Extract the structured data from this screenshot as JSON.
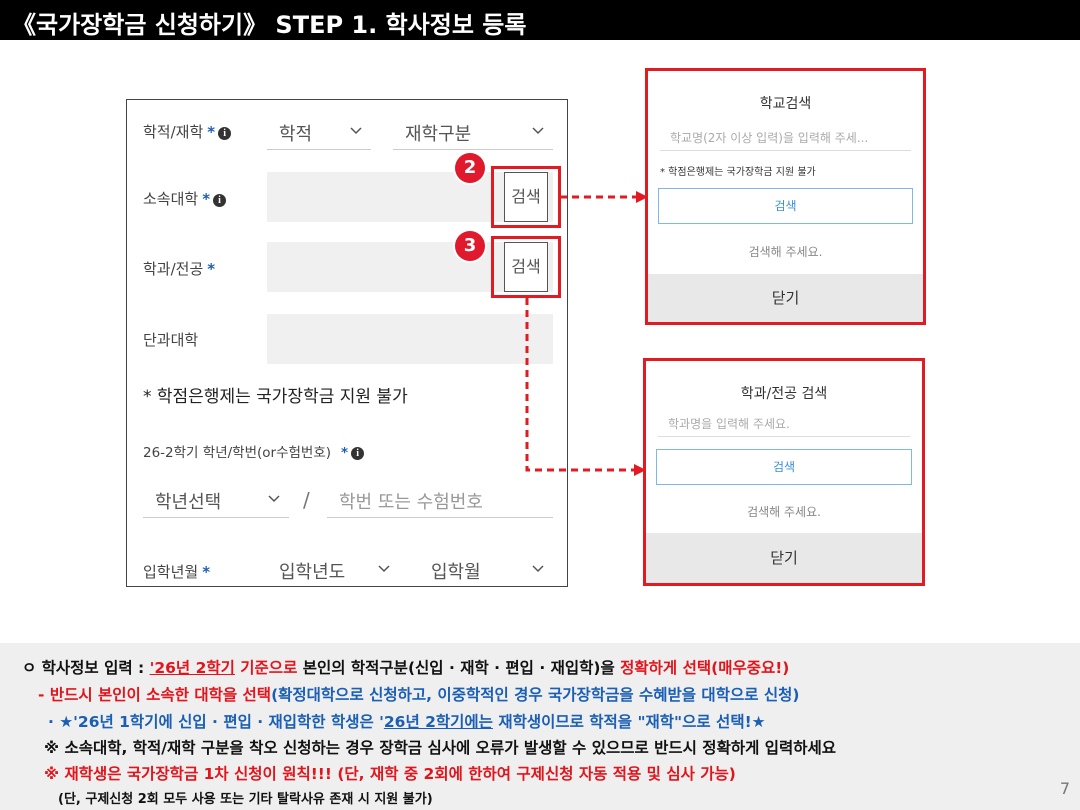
{
  "title": "《국가장학금 신청하기》 STEP 1. 학사정보 등록",
  "form": {
    "row1": {
      "label": "학적/재학",
      "required": "*",
      "info": "i",
      "select1": "학적",
      "select2": "재학구분"
    },
    "row2": {
      "label": "소속대학",
      "required": "*",
      "info": "i",
      "button": "검색",
      "badge": "2"
    },
    "row3": {
      "label": "학과/전공",
      "required": "*",
      "button": "검색",
      "badge": "3"
    },
    "row4": {
      "label": "단과대학"
    },
    "note": "* 학점은행제는 국가장학금 지원 불가",
    "row5": {
      "label": "26-2학기 학년/학번(or수험번호)",
      "required": "*",
      "info": "i",
      "select": "학년선택",
      "slash": "/",
      "placeholder": "학번 또는 수험번호"
    },
    "row6": {
      "label": "입학년월",
      "required": "*",
      "select1": "입학년도",
      "select2": "입학월"
    }
  },
  "popup_school": {
    "title": "학교검색",
    "placeholder": "학교명(2자 이상 입력)을 입력해 주세...",
    "note": "* 학점은행제는 국가장학금 지원 불가",
    "search": "검색",
    "empty": "검색해 주세요.",
    "close": "닫기"
  },
  "popup_major": {
    "title": "학과/전공 검색",
    "placeholder": "학과명을 입력해 주세요.",
    "search": "검색",
    "empty": "검색해 주세요.",
    "close": "닫기"
  },
  "info": {
    "l1": {
      "a": "ㅇ 학사정보 입력 : ",
      "b": "'26년 2학기",
      "c": " 기준으로",
      "d": " 본인의 학적구분(신입 · 재학 · 편입 · 재입학)을 ",
      "e": "정확하게 선택(매우중요!)"
    },
    "l2": {
      "a": "- 반드시 본인이 소속한 대학을 선택",
      "b": "(확정대학으로 신청하고, 이중학적인 경우 국가장학금을 수혜받을 대학으로 신청)"
    },
    "l3": {
      "a": "· ★'26년 1학기에 신입 · 편입 · 재입학한 학생은 '",
      "b": "26년 2학기에는",
      "c": " 재학생이므로 학적을 \"재학\"으로 선택!★"
    },
    "l4": "※ 소속대학, 학적/재학 구분을 착오 신청하는 경우 장학금 심사에 오류가 발생할 수 있으므로 반드시 정확하게 입력하세요",
    "l5": "※ 재학생은 국가장학금 1차 신청이 원칙!!! (단, 재학 중 2회에 한하여 구제신청 자동 적용 및 심사 가능)",
    "l6": "(단, 구제신청 2회 모두 사용 또는 기타 탈락사유 존재 시 지원 불가)"
  },
  "page_number": "7",
  "colors": {
    "accent_red": "#e21a22",
    "blue": "#1a5fb4",
    "title_bg": "#000000"
  }
}
